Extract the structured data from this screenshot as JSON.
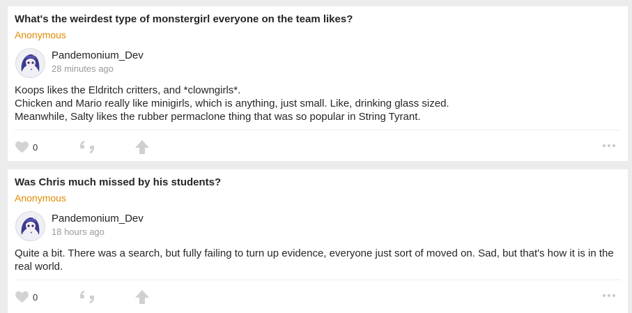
{
  "posts": [
    {
      "question": "What's the weirdest type of monstergirl everyone on the team likes?",
      "asker": "Anonymous",
      "author": "Pandemonium_Dev",
      "time": "28 minutes ago",
      "answer_lines": [
        "Koops likes the Eldritch critters, and *clowngirls*.",
        "Chicken and Mario really like minigirls, which is anything, just small. Like, drinking glass sized.",
        "Meanwhile, Salty likes the rubber permaclone thing that was so popular in String Tyrant."
      ],
      "like_count": "0"
    },
    {
      "question": "Was Chris much missed by his students?",
      "asker": "Anonymous",
      "author": "Pandemonium_Dev",
      "time": "18 hours ago",
      "answer_lines": [
        "Quite a bit. There was a search, but fully failing to turn up evidence, everyone just sort of moved on. Sad, but that's how it is in the real world."
      ],
      "like_count": "0"
    }
  ],
  "icons": {
    "like": "heart-icon",
    "share": "quote-icon",
    "reward": "arrow-up-icon",
    "more": "ellipsis-icon"
  },
  "colors": {
    "asker": "#e08a00",
    "icon": "#cfcfcf",
    "background": "#ececec",
    "card": "#ffffff"
  }
}
